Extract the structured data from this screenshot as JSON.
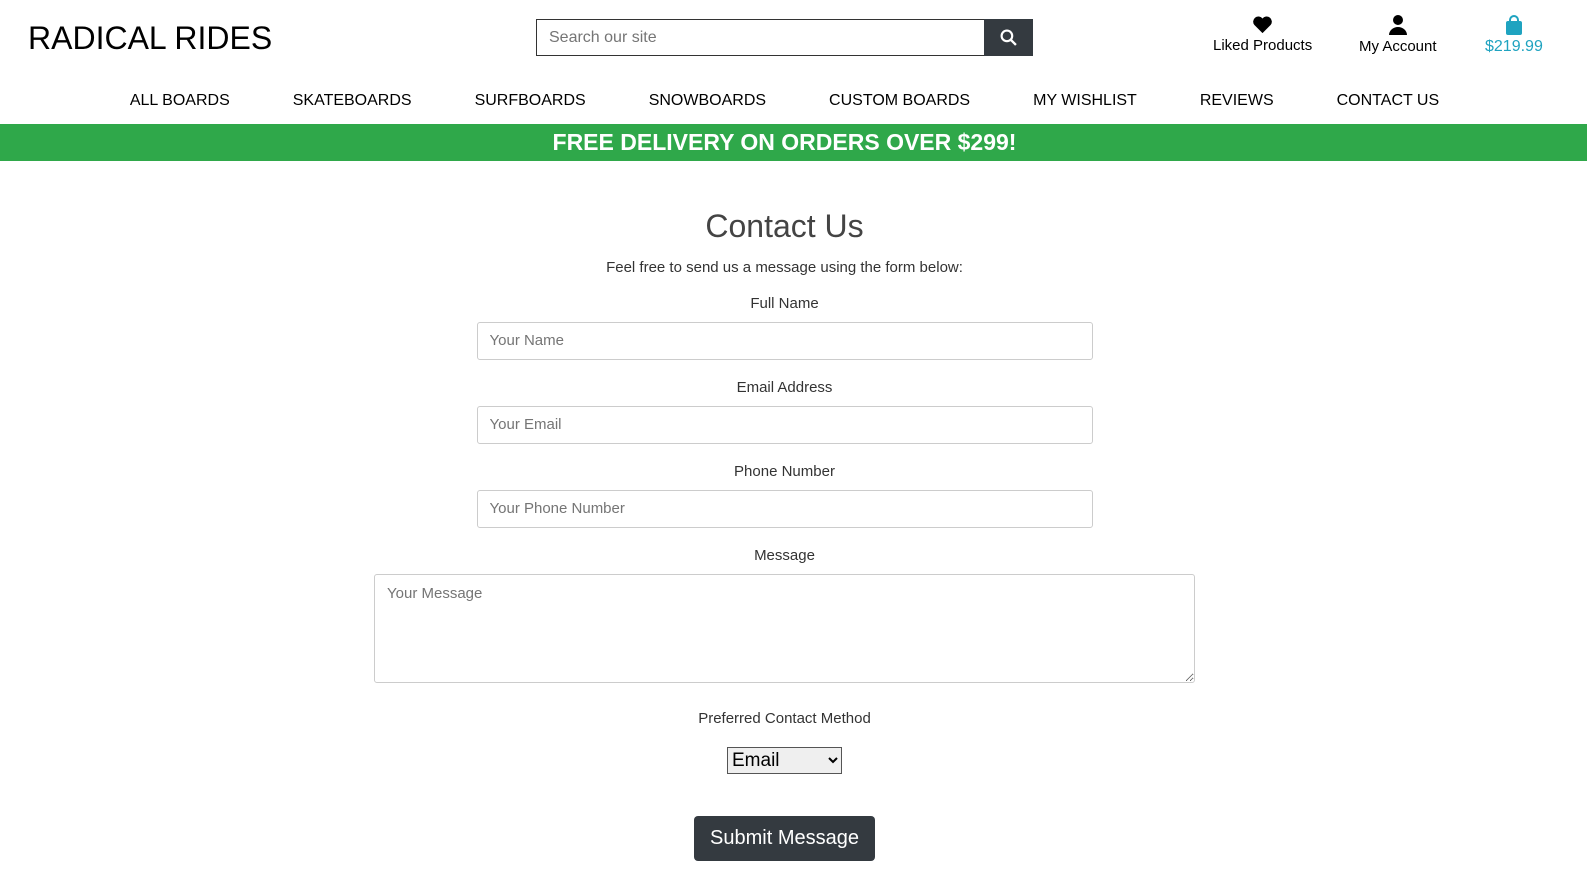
{
  "header": {
    "logo": "RADICAL RIDES",
    "search_placeholder": "Search our site",
    "liked": "Liked Products",
    "account": "My Account",
    "cart_total": "$219.99"
  },
  "nav": [
    "ALL BOARDS",
    "SKATEBOARDS",
    "SURFBOARDS",
    "SNOWBOARDS",
    "CUSTOM BOARDS",
    "MY WISHLIST",
    "REVIEWS",
    "CONTACT US"
  ],
  "banner": "FREE DELIVERY ON ORDERS OVER $299!",
  "form": {
    "title": "Contact Us",
    "subtitle": "Feel free to send us a message using the form below:",
    "name_label": "Full Name",
    "name_placeholder": "Your Name",
    "email_label": "Email Address",
    "email_placeholder": "Your Email",
    "phone_label": "Phone Number",
    "phone_placeholder": "Your Phone Number",
    "message_label": "Message",
    "message_placeholder": "Your Message",
    "method_label": "Preferred Contact Method",
    "method_value": "Email",
    "submit": "Submit Message"
  },
  "colors": {
    "banner": "#2fa84a",
    "cart": "#1fa3c0",
    "button": "#343a40"
  }
}
